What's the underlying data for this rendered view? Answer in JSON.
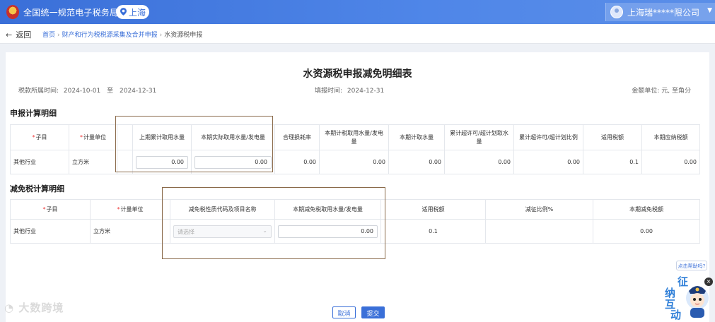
{
  "header": {
    "app_title": "全国统一规范电子税务局",
    "region": "上海",
    "company": "上海瑞*****限公司"
  },
  "breadcrumb": {
    "back_label": "返回",
    "items": [
      "首页",
      "财产和行为税税源采集及合并申报",
      "水资源税申报"
    ]
  },
  "report": {
    "title": "水资源税申报减免明细表",
    "period_label": "税款所属时间:",
    "period_start": "2024-10-01",
    "period_to": "至",
    "period_end": "2024-12-31",
    "fill_label": "填报时间:",
    "fill_date": "2024-12-31",
    "unit_label": "金额单位: 元, 至角分"
  },
  "calc_section": {
    "title": "申报计算明细",
    "headers": [
      "子目",
      "计量单位",
      "",
      "上期累计取用水量",
      "本期实际取用水量/发电量",
      "合理损耗率",
      "本期计税取用水量/发电量",
      "本期计取水量",
      "累计超许可/超计划取水量",
      "累计超许可/超计划比例",
      "适用税额",
      "本期应纳税额"
    ],
    "row": {
      "subitem": "其他行业",
      "unit": "立方米",
      "prev_cumulative": "0.00",
      "current_actual": "0.00",
      "loss_rate": "0.00",
      "taxable_volume": "0.00",
      "current_volume": "0.00",
      "cumulative_excess": "0.00",
      "excess_ratio": "0.00",
      "tax_rate": "0.1",
      "tax_payable": "0.00"
    }
  },
  "relief_section": {
    "title": "减免税计算明细",
    "headers": [
      "子目",
      "计量单位",
      "减免税性质代码及项目名称",
      "本期减免税取用水量/发电量",
      "适用税额",
      "减征比例%",
      "本期减免税额"
    ],
    "row": {
      "subitem": "其他行业",
      "unit": "立方米",
      "relief_code_placeholder": "请选择",
      "relief_volume": "0.00",
      "tax_rate": "0.1",
      "reduction_ratio": "",
      "relief_amount": "0.00"
    }
  },
  "actions": {
    "cancel": "取消",
    "submit": "提交"
  },
  "watermark": "大数跨境",
  "help": {
    "tag": "点击帮助吗?",
    "mascot_chars": [
      "征",
      "纳",
      "互",
      "动"
    ]
  }
}
